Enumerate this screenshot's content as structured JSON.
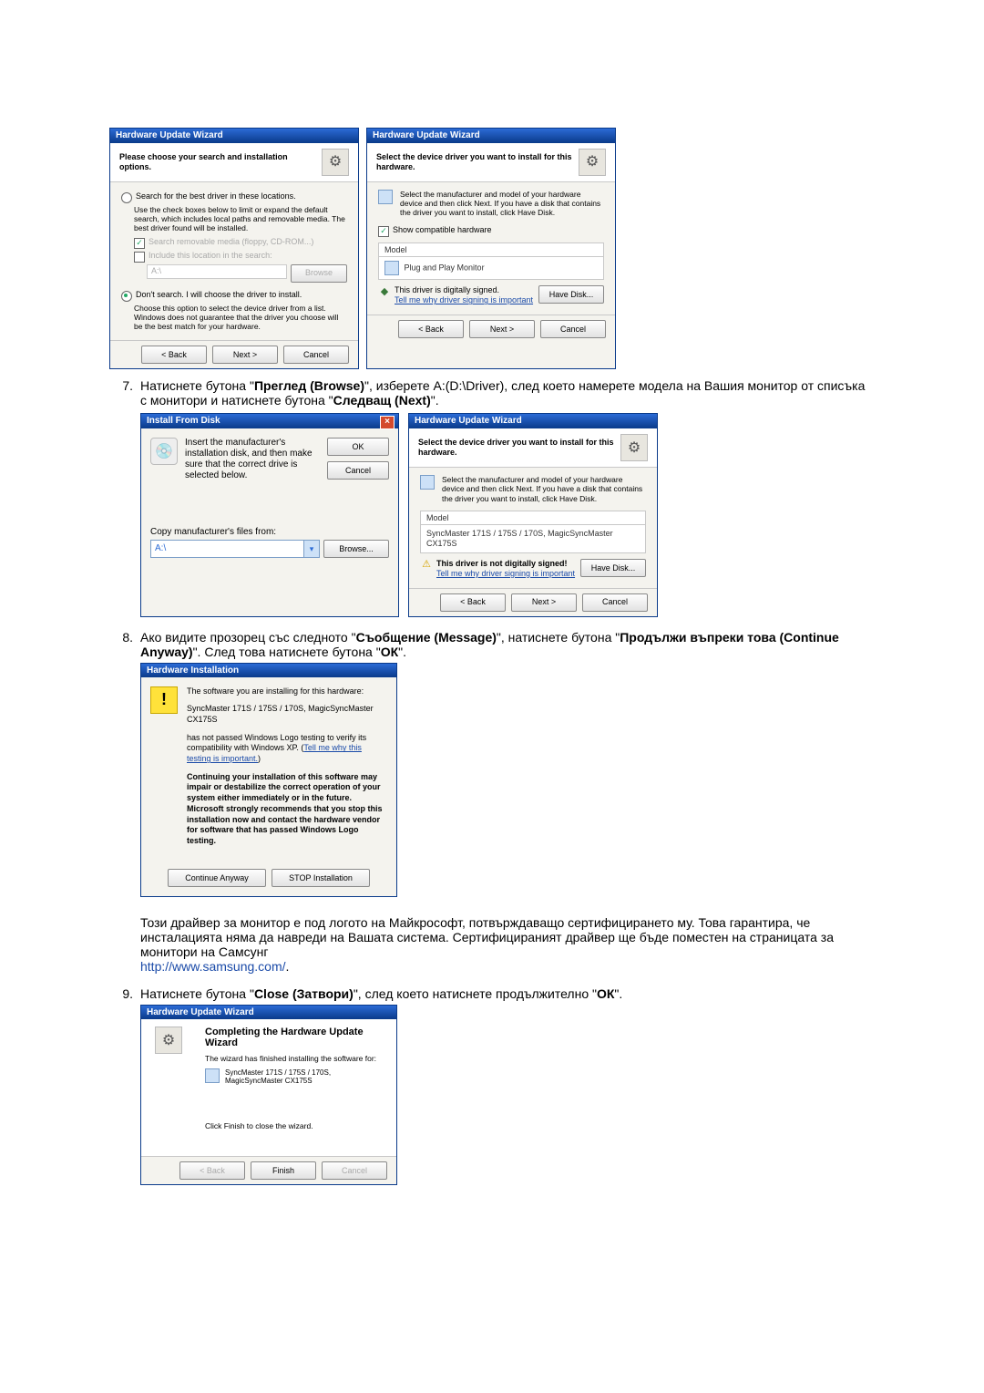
{
  "wizard_title": "Hardware Update Wizard",
  "panelA": {
    "header": "Please choose your search and installation options.",
    "radio_search": "Search for the best driver in these locations.",
    "search_help": "Use the check boxes below to limit or expand the default search, which includes local paths and removable media. The best driver found will be installed.",
    "chk_media": "Search removable media (floppy, CD-ROM...)",
    "chk_include": "Include this location in the search:",
    "path_value": "A:\\",
    "browse": "Browse",
    "radio_dont": "Don't search. I will choose the driver to install.",
    "dont_help": "Choose this option to select the device driver from a list. Windows does not guarantee that the driver you choose will be the best match for your hardware."
  },
  "nav": {
    "back": "< Back",
    "next": "Next >",
    "cancel": "Cancel",
    "finish": "Finish"
  },
  "panelB": {
    "header": "Select the device driver you want to install for this hardware.",
    "info": "Select the manufacturer and model of your hardware device and then click Next. If you have a disk that contains the driver you want to install, click Have Disk.",
    "show_compat": "Show compatible hardware",
    "model_label": "Model",
    "model_item": "Plug and Play Monitor",
    "signed": "This driver is digitally signed.",
    "tell_me": "Tell me why driver signing is important",
    "have_disk": "Have Disk..."
  },
  "step7": {
    "text_a": "Натиснете бутона \"",
    "btn_browse": "Преглед (Browse)",
    "text_b": "\", изберете A:(D:\\Driver), след което намерете модела на Вашия монитор от списъка с монитори и натиснете бутона \"",
    "btn_next": "Следващ (Next)",
    "text_c": "\"."
  },
  "install_from_disk": {
    "title": "Install From Disk",
    "msg": "Insert the manufacturer's installation disk, and then make sure that the correct drive is selected below.",
    "ok": "OK",
    "cancel": "Cancel",
    "copy_label": "Copy manufacturer's files from:",
    "combo_value": "A:\\",
    "browse": "Browse..."
  },
  "panelD": {
    "model_item": "SyncMaster 171S / 175S / 170S, MagicSyncMaster CX175S",
    "not_signed": "This driver is not digitally signed!",
    "tell_me": "Tell me why driver signing is important"
  },
  "step8": {
    "text_a": "Ако видите прозорец със следното \"",
    "msg": "Съобщение (Message)",
    "text_b": "\", натиснете бутона \"",
    "cont": "Продължи въпреки това (Continue Anyway)",
    "text_c": "\". След това натиснете бутона \"",
    "ok": "ОК",
    "text_d": "\"."
  },
  "hi": {
    "title": "Hardware Installation",
    "l1": "The software you are installing for this hardware:",
    "l2": "SyncMaster 171S / 175S / 170S, MagicSyncMaster CX175S",
    "l3a": "has not passed Windows Logo testing to verify its compatibility with Windows XP. (",
    "l3link": "Tell me why this testing is important.",
    "l3b": ")",
    "l4": "Continuing your installation of this software may impair or destabilize the correct operation of your system either immediately or in the future. Microsoft strongly recommends that you stop this installation now and contact the hardware vendor for software that has passed Windows Logo testing.",
    "cont": "Continue Anyway",
    "stop": "STOP Installation"
  },
  "para_after8": "Този драйвер за монитор е под логото на Майкрософт, потвърждаващо сертифицирането му. Това гарантира, че инсталацията няма да навреди на Вашата система. Сертифицираният драйвер ще бъде поместен на страницата за монитори на Самсунг",
  "samsung_url": "http://www.samsung.com/",
  "step9": {
    "text_a": "Натиснете бутона \"",
    "close": "Close (Затвори)",
    "text_b": "\", след което натиснете продължително \"",
    "ok": "ОК",
    "text_c": "\"."
  },
  "fin": {
    "hdr": "Completing the Hardware Update Wizard",
    "line": "The wizard has finished installing the software for:",
    "model": "SyncMaster 171S / 175S / 170S, MagicSyncMaster CX175S",
    "click_finish": "Click Finish to close the wizard."
  }
}
